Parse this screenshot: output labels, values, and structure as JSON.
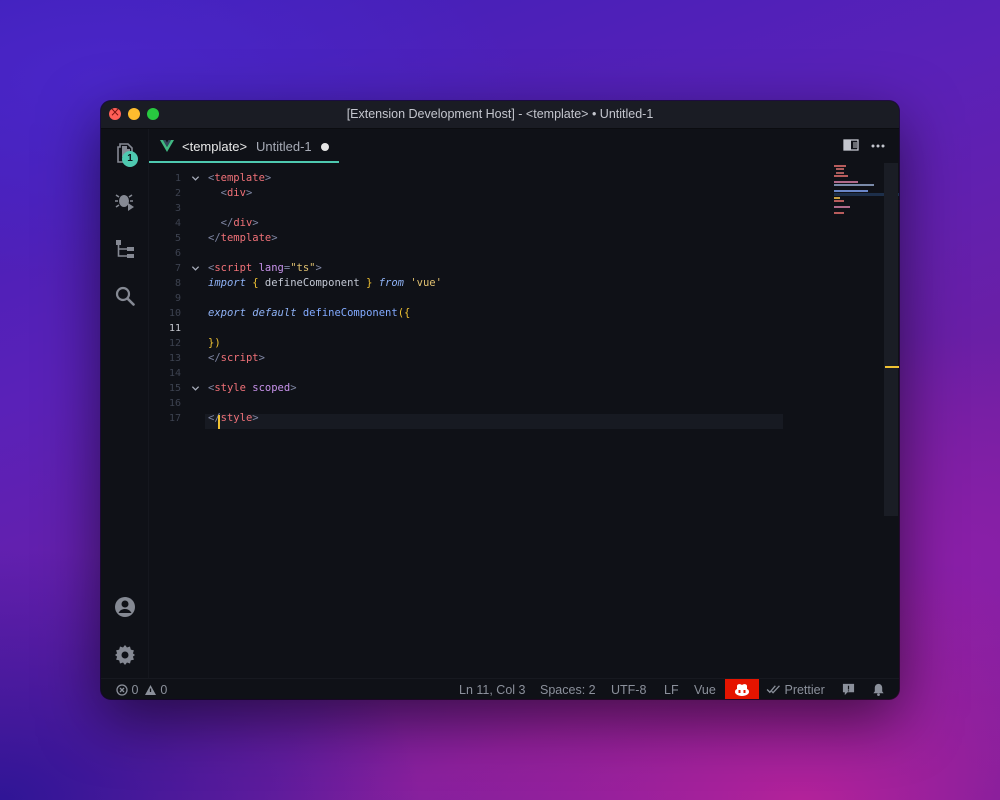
{
  "window": {
    "title": "[Extension Development Host] - <template> • Untitled-1"
  },
  "activity_bar": {
    "explorer_badge": "1",
    "icons": [
      "files-icon",
      "debug-icon",
      "source-tree-icon",
      "search-icon",
      "account-icon",
      "gear-icon"
    ]
  },
  "tab": {
    "name": "<template>",
    "file": "Untitled-1",
    "dirty": true
  },
  "editor": {
    "active_line": 11,
    "line_numbers": [
      "1",
      "2",
      "3",
      "4",
      "5",
      "6",
      "7",
      "8",
      "9",
      "10",
      "11",
      "12",
      "13",
      "14",
      "15",
      "16",
      "17"
    ],
    "lines": [
      [
        {
          "t": "<",
          "c": "c-br"
        },
        {
          "t": "template",
          "c": "c-tagname"
        },
        {
          "t": ">",
          "c": "c-br"
        }
      ],
      [
        {
          "t": "  "
        },
        {
          "t": "<",
          "c": "c-br"
        },
        {
          "t": "div",
          "c": "c-tagname"
        },
        {
          "t": ">",
          "c": "c-br"
        }
      ],
      [],
      [
        {
          "t": "  "
        },
        {
          "t": "</",
          "c": "c-br"
        },
        {
          "t": "div",
          "c": "c-tagname"
        },
        {
          "t": ">",
          "c": "c-br"
        }
      ],
      [
        {
          "t": "</",
          "c": "c-br"
        },
        {
          "t": "template",
          "c": "c-tagname"
        },
        {
          "t": ">",
          "c": "c-br"
        }
      ],
      [],
      [
        {
          "t": "<",
          "c": "c-br"
        },
        {
          "t": "script",
          "c": "c-tagname"
        },
        {
          "t": " "
        },
        {
          "t": "lang",
          "c": "c-attr"
        },
        {
          "t": "=",
          "c": "c-br"
        },
        {
          "t": "\"ts\"",
          "c": "c-str"
        },
        {
          "t": ">",
          "c": "c-br"
        }
      ],
      [
        {
          "t": "import",
          "c": "c-kw"
        },
        {
          "t": " "
        },
        {
          "t": "{",
          "c": "c-brace"
        },
        {
          "t": " defineComponent ",
          "c": "c-id"
        },
        {
          "t": "}",
          "c": "c-brace"
        },
        {
          "t": " "
        },
        {
          "t": "from",
          "c": "c-kw"
        },
        {
          "t": " "
        },
        {
          "t": "'vue'",
          "c": "c-str"
        }
      ],
      [],
      [
        {
          "t": "export",
          "c": "c-kw"
        },
        {
          "t": " "
        },
        {
          "t": "default",
          "c": "c-kw"
        },
        {
          "t": " "
        },
        {
          "t": "defineComponent",
          "c": "c-fn"
        },
        {
          "t": "(",
          "c": "c-brace"
        },
        {
          "t": "{",
          "c": "c-brace"
        }
      ],
      [],
      [
        {
          "t": "}",
          "c": "c-brace"
        },
        {
          "t": ")",
          "c": "c-brace"
        }
      ],
      [
        {
          "t": "</",
          "c": "c-br"
        },
        {
          "t": "script",
          "c": "c-tagname"
        },
        {
          "t": ">",
          "c": "c-br"
        }
      ],
      [],
      [
        {
          "t": "<",
          "c": "c-br"
        },
        {
          "t": "style",
          "c": "c-tagname"
        },
        {
          "t": " "
        },
        {
          "t": "scoped",
          "c": "c-attr"
        },
        {
          "t": ">",
          "c": "c-br"
        }
      ],
      [],
      [
        {
          "t": "</",
          "c": "c-br"
        },
        {
          "t": "style",
          "c": "c-tagname"
        },
        {
          "t": ">",
          "c": "c-br"
        }
      ]
    ],
    "fold_lines": [
      1,
      7,
      15
    ]
  },
  "status_bar": {
    "errors": "0",
    "warnings": "0",
    "position": "Ln 11, Col 3",
    "indent": "Spaces: 2",
    "encoding": "UTF-8",
    "eol": "LF",
    "language": "Vue",
    "formatter": "Prettier"
  },
  "colors": {
    "accent": "#4ec9b0",
    "cursor": "#f0c233",
    "copilot_bg": "#e51400"
  }
}
